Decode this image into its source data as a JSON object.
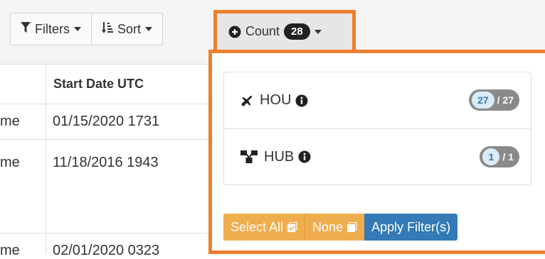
{
  "toolbar": {
    "filters_label": "Filters",
    "sort_label": "Sort",
    "count_label": "Count",
    "count_value": "28"
  },
  "table": {
    "header_date": "Start Date UTC",
    "left_fragments": [
      "me",
      "me",
      "me"
    ],
    "dates": [
      "01/15/2020 1731",
      "11/18/2016 1943",
      "02/01/2020 0323"
    ]
  },
  "dropdown": {
    "items": [
      {
        "icon": "plane-icon",
        "label": "HOU",
        "count": "27",
        "total": "/ 27"
      },
      {
        "icon": "hub-icon",
        "label": "HUB",
        "count": "1",
        "total": "/ 1"
      }
    ],
    "select_all_label": "Select All",
    "none_label": "None",
    "apply_label": "Apply Filter(s)"
  },
  "colors": {
    "highlight": "#ee7f2d",
    "warning": "#f0ad4e",
    "primary": "#337ab7",
    "badge_dark": "#222222"
  }
}
